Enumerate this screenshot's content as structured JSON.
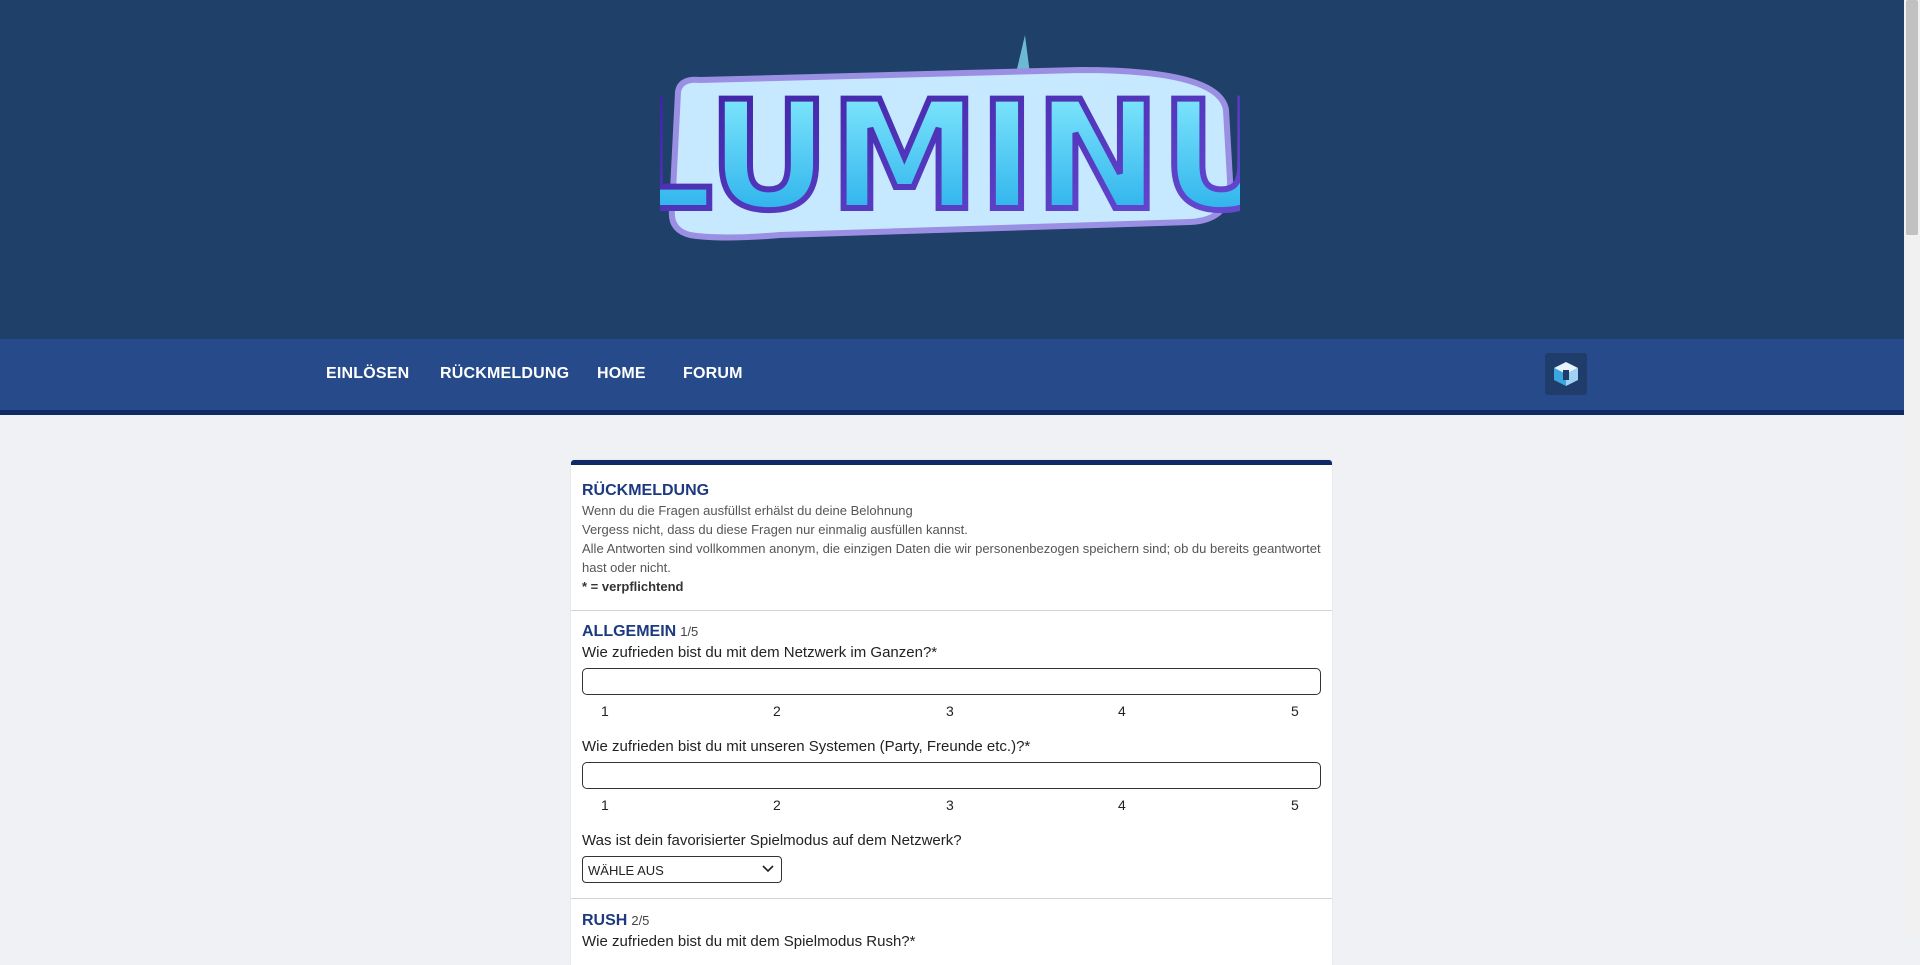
{
  "brand": {
    "logo_text": "LUMINU"
  },
  "nav": {
    "items": [
      {
        "label": "EINLÖSEN"
      },
      {
        "label": "RÜCKMELDUNG"
      },
      {
        "label": "HOME"
      },
      {
        "label": "FORUM"
      }
    ],
    "profile_icon": "minecraft-block-icon"
  },
  "form": {
    "intro": {
      "title": "RÜCKMELDUNG",
      "lines": [
        "Wenn du die Fragen ausfüllst erhälst du deine Belohnung",
        "Vergess nicht, dass du diese Fragen nur einmalig ausfüllen kannst.",
        "Alle Antworten sind vollkommen anonym, die einzigen Daten die wir personenbezogen speichern sind; ob du bereits geantwortet hast oder nicht."
      ],
      "required_prefix": "* = ",
      "required_label": "verpflichtend"
    },
    "sections": [
      {
        "title": "ALLGEMEIN",
        "count": "1/5",
        "questions": [
          {
            "text": "Wie zufrieden bist du mit dem Netzwerk im Ganzen?*",
            "scale": [
              "1",
              "2",
              "3",
              "4",
              "5"
            ]
          },
          {
            "text": "Wie zufrieden bist du mit unseren Systemen (Party, Freunde etc.)?*",
            "scale": [
              "1",
              "2",
              "3",
              "4",
              "5"
            ]
          },
          {
            "text": "Was ist dein favorisierter Spielmodus auf dem Netzwerk?",
            "select_value": "WÄHLE AUS"
          }
        ]
      },
      {
        "title": "RUSH",
        "count": "2/5",
        "questions": [
          {
            "text": "Wie zufrieden bist du mit dem Spielmodus Rush?*"
          }
        ]
      }
    ]
  },
  "colors": {
    "hero_bg": "#1f4068",
    "nav_bg": "#274b8a",
    "accent_dark": "#102a66",
    "section_title": "#1d3a80",
    "page_bg": "#eff1f5"
  }
}
